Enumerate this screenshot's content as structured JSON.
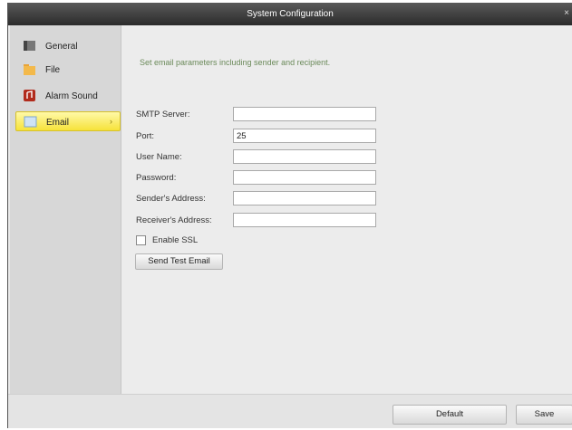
{
  "window": {
    "title": "System Configuration",
    "close": "×"
  },
  "sidebar": {
    "items": [
      {
        "label": "General",
        "icon": "general-icon"
      },
      {
        "label": "File",
        "icon": "folder-icon"
      },
      {
        "label": "Alarm Sound",
        "icon": "alarm-sound-icon"
      },
      {
        "label": "Email",
        "icon": "email-icon",
        "selected": true
      }
    ]
  },
  "email": {
    "description": "Set email parameters including sender and recipient.",
    "fields": {
      "smtp_server": {
        "label": "SMTP Server:",
        "value": ""
      },
      "port": {
        "label": "Port:",
        "value": "25"
      },
      "user_name": {
        "label": "User Name:",
        "value": ""
      },
      "password": {
        "label": "Password:",
        "value": ""
      },
      "sender_address": {
        "label": "Sender's Address:",
        "value": ""
      },
      "receiver_address": {
        "label": "Receiver's Address:",
        "value": ""
      }
    },
    "enable_ssl": {
      "label": "Enable SSL",
      "checked": false
    },
    "send_test_label": "Send Test Email"
  },
  "footer": {
    "default_label": "Default",
    "save_label": "Save"
  },
  "colors": {
    "selected_item": "#f6e23a",
    "titlebar": "#2b2b2b",
    "description": "#6b8a5a"
  }
}
